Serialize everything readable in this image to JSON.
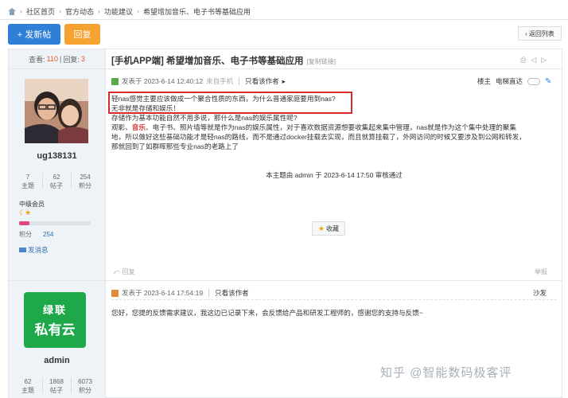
{
  "breadcrumb": [
    "社区首页",
    "官方动态",
    "功能建议",
    "希望增加音乐、电子书等基础应用"
  ],
  "toolbar": {
    "post_label": "+ 发新帖",
    "reply_label": "回复",
    "back_label": "返回列表"
  },
  "thread": {
    "views_label": "查看:",
    "views": "110",
    "divider": "|",
    "replies_label": "回复:",
    "replies": "3",
    "title": "[手机APP端] 希望增加音乐、电子书等基础应用",
    "copy_link": "[复制链接]"
  },
  "post1": {
    "author": {
      "name": "ug138131",
      "stats": [
        {
          "value": "7",
          "label": "主题"
        },
        {
          "value": "62",
          "label": "帖子"
        },
        {
          "value": "254",
          "label": "积分"
        }
      ],
      "rank": "中级会员",
      "level_fraction": 0.14,
      "points_label": "积分",
      "points": "254",
      "message": "发消息"
    },
    "meta": {
      "posted": "发表于 2023-6-14 12:40:12",
      "source": "来自手机",
      "only_author": "只看该作者"
    },
    "floor_label": "楼主",
    "elevator_label": "电梯直达",
    "content": {
      "line1": "轻nas感觉主要应该做成一个聚合性质的东西，为什么普通家庭要用到nas?",
      "line2": "无非就是存储和娱乐！",
      "line3": "存储作为基本功能自然不用多说，那什么是nas的娱乐属性呢?",
      "line4_a": "观影、",
      "line4_red": "音乐",
      "line4_b": "、电子书、照片墙等就是作为nas的娱乐属性，对于喜欢数据资源想要收集起来集中管理，nas就是作为这个集中处理的聚集",
      "line5": "地，所以做好这些基础功能才是轻nas的路线，而不是通过docker挂载去实现，而且就算挂载了，外网访问的时候又要涉及到公网和转发，",
      "line6": "那就回到了如群晖那些专业nas的老路上了"
    },
    "edited_note": "本主题由 admin 于 2023-6-14 17:50 审核通过",
    "favorite_label": "收藏",
    "reply_label": "回复",
    "report_label": "举报"
  },
  "post2": {
    "author": {
      "name": "admin",
      "avatar_line1": "绿联",
      "avatar_line2": "私有云",
      "stats": [
        {
          "value": "62",
          "label": "主题"
        },
        {
          "value": "1868",
          "label": "帖子"
        },
        {
          "value": "6073",
          "label": "积分"
        }
      ]
    },
    "meta": {
      "posted": "发表于 2023-6-14 17:54:19",
      "only_author": "只看该作者"
    },
    "floor_label": "沙发",
    "content": "您好，您提的反馈需求建议，我这边已记录下来，会反馈给产品和研发工程师的，感谢您的支持与反馈~"
  },
  "watermark": "知乎 @智能数码极客评",
  "colors": {
    "primary": "#2f7fd8",
    "reply": "#f5a230",
    "highlight_border": "#d22c2c",
    "avatar2_bg": "#1ea84a"
  }
}
